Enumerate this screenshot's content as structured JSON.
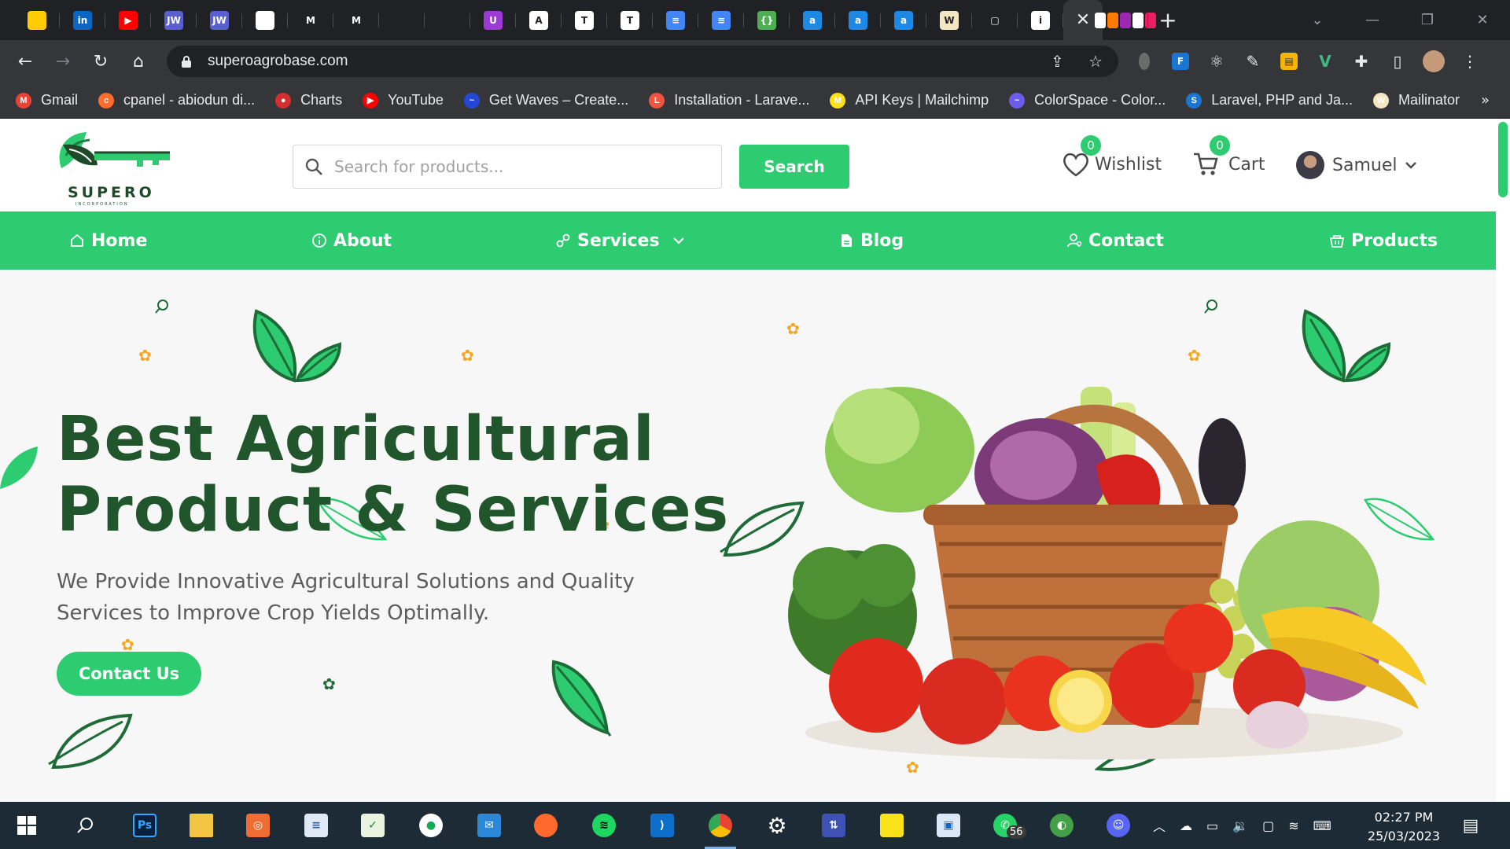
{
  "browser": {
    "tabs": [
      {
        "icon": "mtn-icon",
        "color": "#ffcc00",
        "text": ""
      },
      {
        "icon": "linkedin-icon",
        "color": "#0a66c2",
        "text": "in"
      },
      {
        "icon": "youtube-icon",
        "color": "#ff0000",
        "text": "▶"
      },
      {
        "icon": "jw-icon",
        "color": "#5a5fcf",
        "text": "JW"
      },
      {
        "icon": "jw-icon",
        "color": "#5a5fcf",
        "text": "JW"
      },
      {
        "icon": "canva-icon",
        "color": "#ffffff",
        "text": ""
      },
      {
        "icon": "gmail-icon",
        "color": "#202124",
        "text": "M"
      },
      {
        "icon": "gmail-icon",
        "color": "#202124",
        "text": "M"
      },
      {
        "icon": "github-icon",
        "color": "#202124",
        "text": ""
      },
      {
        "icon": "github-icon",
        "color": "#202124",
        "text": ""
      },
      {
        "icon": "uphold-icon",
        "color": "#9b3ad4",
        "text": "U"
      },
      {
        "icon": "adobe-icon",
        "color": "#ffffff",
        "text": "A"
      },
      {
        "icon": "trello-icon",
        "color": "#ffffff",
        "text": "T"
      },
      {
        "icon": "trello-icon",
        "color": "#ffffff",
        "text": "T"
      },
      {
        "icon": "docs-icon",
        "color": "#4285f4",
        "text": "≡"
      },
      {
        "icon": "docs-icon",
        "color": "#4285f4",
        "text": "≡"
      },
      {
        "icon": "code-icon",
        "color": "#4caf50",
        "text": "{}"
      },
      {
        "icon": "asana-icon",
        "color": "#1e88e5",
        "text": "a"
      },
      {
        "icon": "asana-icon",
        "color": "#1e88e5",
        "text": "a"
      },
      {
        "icon": "asana-icon",
        "color": "#1e88e5",
        "text": "a"
      },
      {
        "icon": "mailinator-icon",
        "color": "#f4e6c2",
        "text": "W"
      },
      {
        "icon": "crop-icon",
        "color": "#202124",
        "text": "▢"
      },
      {
        "icon": "info-icon",
        "color": "#ffffff",
        "text": "i"
      }
    ],
    "active_tab_close": "✕",
    "new_tab": "+",
    "window_controls": [
      "⌄",
      "—",
      "❐",
      "✕"
    ],
    "url": "superoagrobase.com",
    "bookmarks": [
      {
        "label": "Gmail",
        "color": "#ea4335",
        "letter": "M"
      },
      {
        "label": "cpanel - abiodun di...",
        "color": "#ff6c2c",
        "letter": "c"
      },
      {
        "label": "Charts",
        "color": "#d32f2f",
        "letter": "●"
      },
      {
        "label": "YouTube",
        "color": "#ff0000",
        "letter": "▶"
      },
      {
        "label": "Get Waves – Create...",
        "color": "#2447d6",
        "letter": "~"
      },
      {
        "label": "Installation - Larave...",
        "color": "#f05340",
        "letter": "L"
      },
      {
        "label": "API Keys | Mailchimp",
        "color": "#ffe01b",
        "letter": "M"
      },
      {
        "label": "ColorSpace - Color...",
        "color": "#6c5ce7",
        "letter": "~"
      },
      {
        "label": "Laravel, PHP and Ja...",
        "color": "#1976d2",
        "letter": "S"
      },
      {
        "label": "Mailinator",
        "color": "#f4e6c2",
        "letter": "W"
      }
    ],
    "bookmarks_more": "»"
  },
  "site": {
    "brand": {
      "name": "SUPERO",
      "sub": "INCORPORATION"
    },
    "search": {
      "placeholder": "Search for products...",
      "button": "Search"
    },
    "wishlist": {
      "label": "Wishlist",
      "count": "0"
    },
    "cart": {
      "label": "Cart",
      "count": "0"
    },
    "user": {
      "name": "Samuel"
    },
    "nav": {
      "home": "Home",
      "about": "About",
      "services": "Services",
      "blog": "Blog",
      "contact": "Contact",
      "products": "Products"
    },
    "hero": {
      "title_line1": "Best Agricultural",
      "title_line2": "Product & Services",
      "subtitle": "We Provide Innovative Agricultural Solutions and Quality Services to Improve Crop Yields Optimally.",
      "cta": "Contact Us"
    },
    "colors": {
      "accent": "#2ecc71",
      "title": "#21552c"
    }
  },
  "taskbar": {
    "whatsapp_badge": "56",
    "time": "02:27 PM",
    "date": "25/03/2023"
  }
}
